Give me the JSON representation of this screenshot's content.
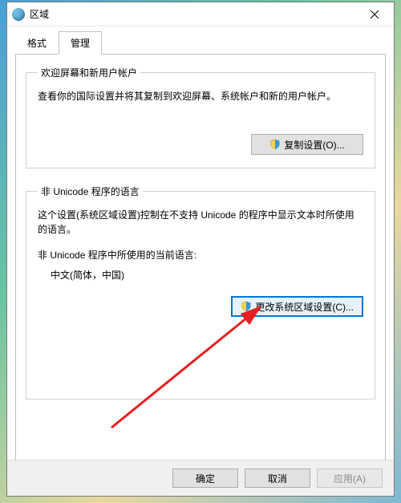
{
  "window": {
    "title": "区域"
  },
  "tabs": {
    "format": "格式",
    "admin": "管理"
  },
  "groups": {
    "welcome": {
      "legend": "欢迎屏幕和新用户帐户",
      "desc": "查看你的国际设置并将其复制到欢迎屏幕、系统帐户和新的用户帐户。",
      "button": "复制设置(O)..."
    },
    "nonunicode": {
      "legend": "非 Unicode 程序的语言",
      "desc": "这个设置(系统区域设置)控制在不支持 Unicode 的程序中显示文本时所使用的语言。",
      "current_label": "非 Unicode 程序中所使用的当前语言:",
      "current_value": "中文(简体，中国)",
      "button": "更改系统区域设置(C)..."
    }
  },
  "footer": {
    "ok": "确定",
    "cancel": "取消",
    "apply": "应用(A)"
  }
}
